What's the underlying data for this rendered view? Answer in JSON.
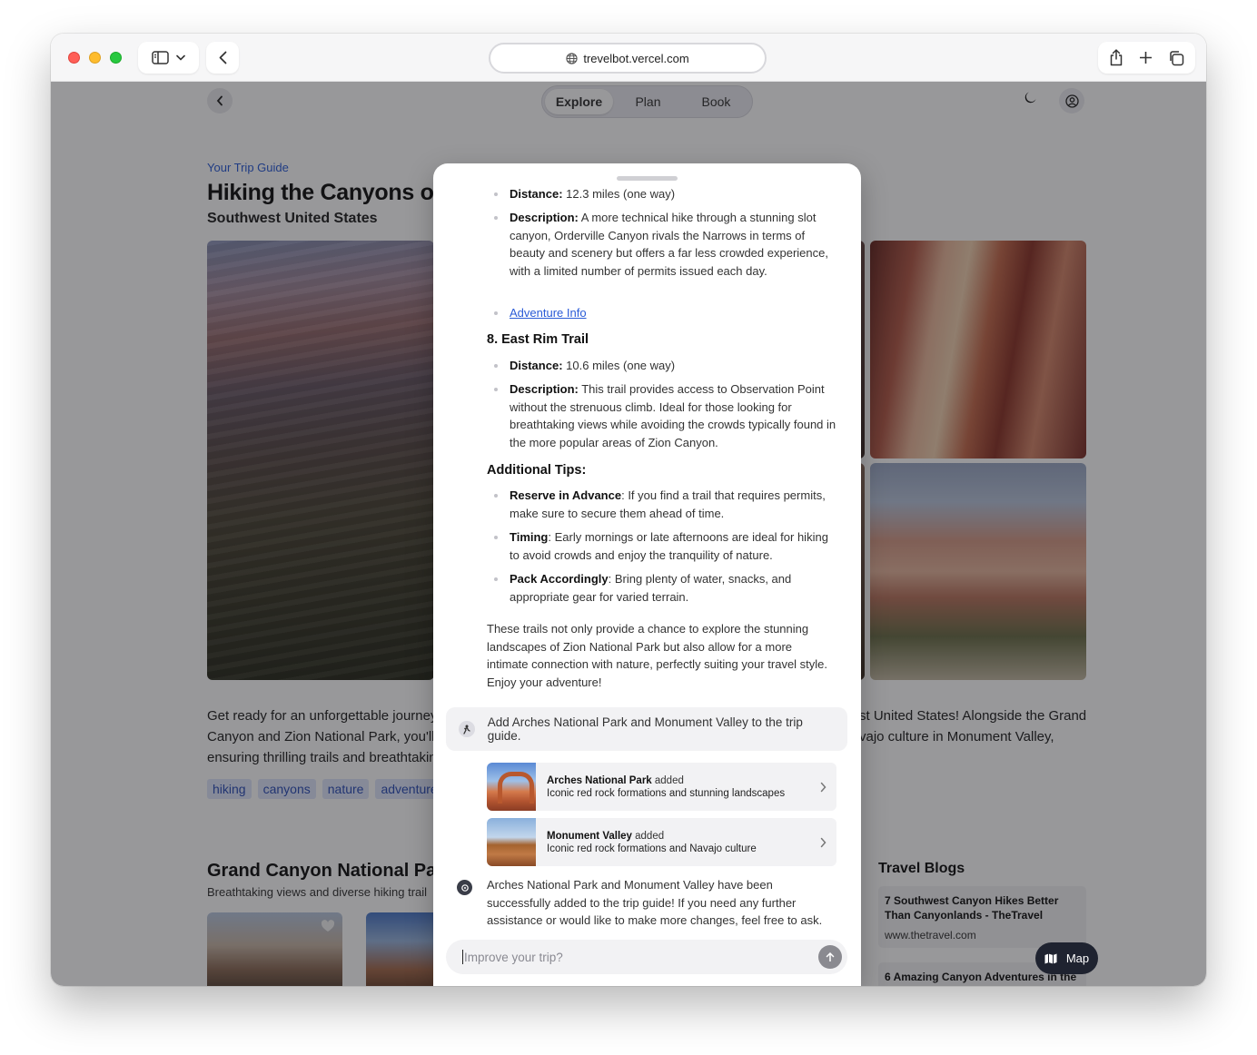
{
  "browser": {
    "url": "trevelbot.vercel.com"
  },
  "nav": {
    "tabs": [
      {
        "label": "Explore",
        "active": true
      },
      {
        "label": "Plan",
        "active": false
      },
      {
        "label": "Book",
        "active": false
      }
    ]
  },
  "guide": {
    "eyebrow": "Your Trip Guide",
    "title": "Hiking the Canyons of",
    "subtitle": "Southwest United States",
    "intro_left": [
      "Get ready for an unforgettable journey",
      "Canyon and Zion National Park, you'll i",
      "ensuring thrilling trails and breathtakin"
    ],
    "intro_right": [
      "st United States! Alongside the Grand",
      "vajo culture in Monument Valley,"
    ],
    "tags": [
      "hiking",
      "canyons",
      "nature",
      "adventure"
    ]
  },
  "sections": {
    "grand_canyon_title": "Grand Canyon National Parl",
    "grand_canyon_sub": "Breathtaking views and diverse hiking trail",
    "blogs_title": "Travel Blogs",
    "blogs": [
      {
        "title": "7 Southwest Canyon Hikes Better Than Canyonlands - TheTravel",
        "url": "www.thetravel.com"
      },
      {
        "title": "6 Amazing Canyon Adventures in the"
      }
    ],
    "map_label": "Map"
  },
  "chat": {
    "distance_label": "Distance:",
    "description_label": "Description:",
    "item7_distance": "12.3 miles (one way)",
    "item7_description": "A more technical hike through a stunning slot canyon, Orderville Canyon rivals the Narrows in terms of beauty and scenery but offers a far less crowded experience, with a limited number of permits issued each day.",
    "adventure_link": "Adventure Info",
    "item8_title": "8. East Rim Trail",
    "item8_distance": "10.6 miles (one way)",
    "item8_description": "This trail provides access to Observation Point without the strenuous climb. Ideal for those looking for breathtaking views while avoiding the crowds typically found in the more popular areas of Zion Canyon.",
    "tips_title": "Additional Tips:",
    "tips": [
      {
        "label": "Reserve in Advance",
        "text": ": If you find a trail that requires permits, make sure to secure them ahead of time."
      },
      {
        "label": "Timing",
        "text": ": Early mornings or late afternoons are ideal for hiking to avoid crowds and enjoy the tranquility of nature."
      },
      {
        "label": "Pack Accordingly",
        "text": ": Bring plenty of water, snacks, and appropriate gear for varied terrain."
      }
    ],
    "closing": "These trails not only provide a chance to explore the stunning landscapes of Zion National Park but also allow for a more intimate connection with nature, perfectly suiting your travel style. Enjoy your adventure!",
    "user_message": "Add Arches National Park and Monument Valley to the trip guide.",
    "added": [
      {
        "name": "Arches National Park",
        "status": "added",
        "desc": "Iconic red rock formations and stunning landscapes"
      },
      {
        "name": "Monument Valley",
        "status": "added",
        "desc": "Iconic red rock formations and Navajo culture"
      }
    ],
    "bot_reply": "Arches National Park and Monument Valley have been successfully added to the trip guide! If you need any further assistance or would like to make more changes, feel free to ask.",
    "input_placeholder": "Improve your trip?"
  }
}
